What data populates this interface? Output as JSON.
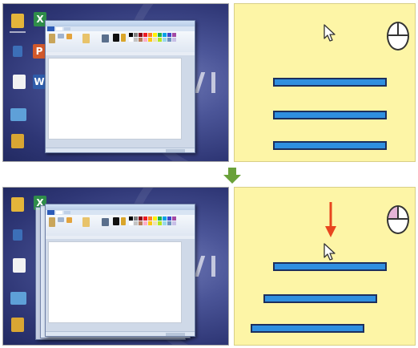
{
  "top_step": {
    "pointer": "arrow-cursor-icon",
    "mouse": "mouse-icon",
    "left_button_pressed": false,
    "press_indicator": false
  },
  "transition": {
    "arrow": "down-arrow-icon",
    "color": "#6aa13a"
  },
  "bottom_step": {
    "pointer": "arrow-cursor-icon",
    "mouse": "mouse-icon",
    "left_button_pressed": true,
    "press_indicator": true,
    "press_color": "#e8451e"
  },
  "desktop_icons": [
    "folder-icon",
    "excel-icon",
    "powerpoint-icon",
    "word-icon",
    "document-icon",
    "computer-icon",
    "folder-icon"
  ],
  "colors": {
    "note_background": "#fdf5a6",
    "bar_fill": "#2f8fe0",
    "bar_border": "#1c2f5e",
    "mouse_button_pressed": "#e6b4d7"
  }
}
